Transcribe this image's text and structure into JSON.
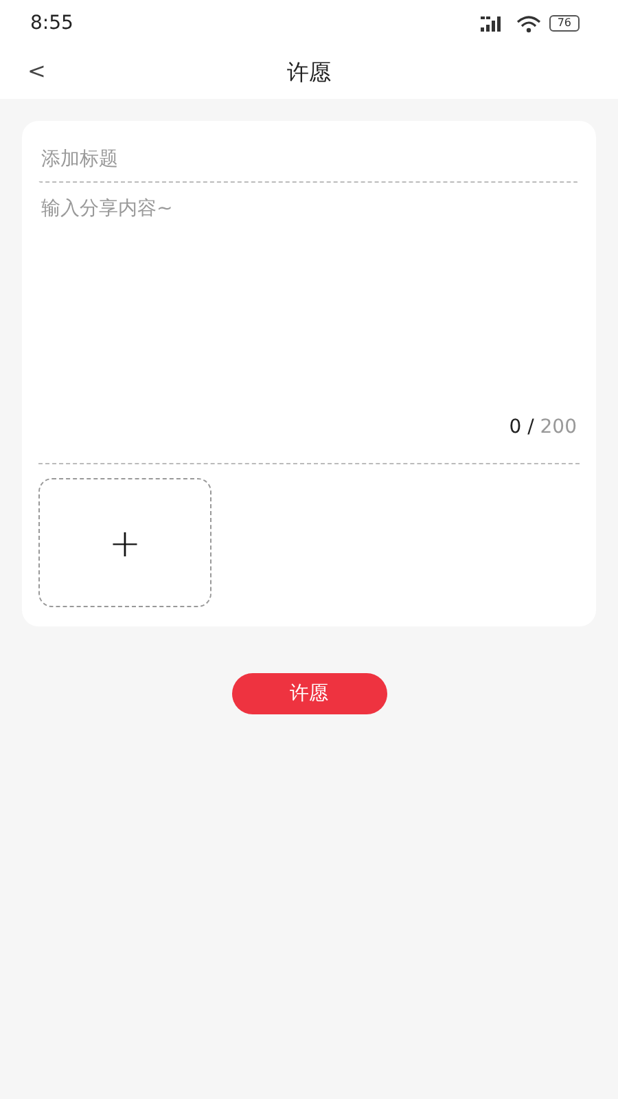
{
  "status_bar": {
    "time": "8:55",
    "battery": "76"
  },
  "header": {
    "back": "<",
    "title": "许愿"
  },
  "form": {
    "title_field": {
      "placeholder": "添加标题"
    },
    "content_field": {
      "placeholder": "输入分享内容~"
    },
    "counter": {
      "typed": "0",
      "separator": "/",
      "limit": "200"
    },
    "upload": {
      "symbol": "+"
    }
  },
  "submit_button": "许愿"
}
